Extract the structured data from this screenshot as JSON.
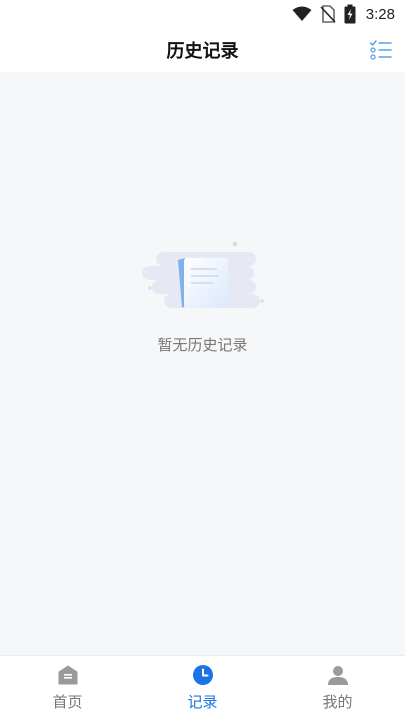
{
  "status_bar": {
    "time": "3:28",
    "icons": [
      "wifi-icon",
      "no-sim-icon",
      "battery-charging-icon"
    ]
  },
  "header": {
    "title": "历史记录",
    "filter_icon": "checklist-icon"
  },
  "empty_state": {
    "illustration": "empty-document-icon",
    "message": "暂无历史记录"
  },
  "bottom_nav": {
    "active_index": 1,
    "items": [
      {
        "label": "首页",
        "icon": "home-icon"
      },
      {
        "label": "记录",
        "icon": "clock-icon"
      },
      {
        "label": "我的",
        "icon": "user-icon"
      }
    ]
  },
  "colors": {
    "accent": "#1b74e4",
    "inactive": "#9a9a9a",
    "background": "#f6f7f9"
  }
}
